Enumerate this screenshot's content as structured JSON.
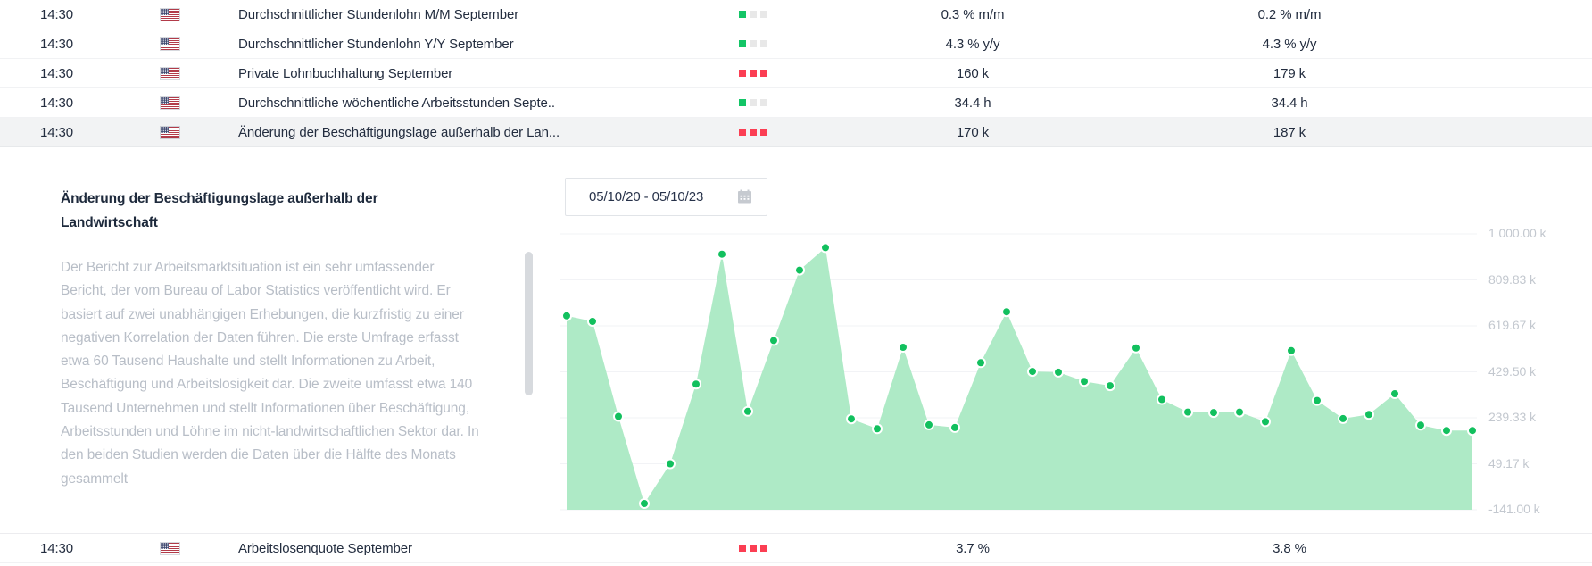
{
  "colors": {
    "impact_green": "#13c566",
    "impact_red": "#fb3e53",
    "impact_gray": "#e8e8e8",
    "area_fill": "#aeeac6",
    "marker_green": "#12c05e",
    "grid_line": "#f2f3f6",
    "selected_row_bg": "#f2f3f4",
    "text_dark": "#232d3f",
    "text_muted": "#b8bec7"
  },
  "table": {
    "rows": [
      {
        "time": "14:30",
        "country_icon": "us-flag-icon",
        "name": "Durchschnittlicher Stundenlohn M/M September",
        "impact": [
          "green",
          "gray",
          "gray"
        ],
        "forecast": "0.3 % m/m",
        "previous": "0.2 % m/m",
        "selected": false,
        "position": "top"
      },
      {
        "time": "14:30",
        "country_icon": "us-flag-icon",
        "name": "Durchschnittlicher Stundenlohn Y/Y September",
        "impact": [
          "green",
          "gray",
          "gray"
        ],
        "forecast": "4.3 % y/y",
        "previous": "4.3 % y/y",
        "selected": false,
        "position": "top"
      },
      {
        "time": "14:30",
        "country_icon": "us-flag-icon",
        "name": "Private Lohnbuchhaltung September",
        "impact": [
          "red",
          "red",
          "red"
        ],
        "forecast": "160 k",
        "previous": "179 k",
        "selected": false,
        "position": "top"
      },
      {
        "time": "14:30",
        "country_icon": "us-flag-icon",
        "name": "Durchschnittliche wöchentliche Arbeitsstunden Septe..",
        "impact": [
          "green",
          "gray",
          "gray"
        ],
        "forecast": "34.4 h",
        "previous": "34.4 h",
        "selected": false,
        "position": "top"
      },
      {
        "time": "14:30",
        "country_icon": "us-flag-icon",
        "name": "Änderung der Beschäftigungslage außerhalb der Lan...",
        "impact": [
          "red",
          "red",
          "red"
        ],
        "forecast": "170 k",
        "previous": "187 k",
        "selected": true,
        "position": "top"
      },
      {
        "time": "14:30",
        "country_icon": "us-flag-icon",
        "name": "Arbeitslosenquote September",
        "impact": [
          "red",
          "red",
          "red"
        ],
        "forecast": "3.7 %",
        "previous": "3.8 %",
        "selected": false,
        "position": "bottom"
      }
    ]
  },
  "detail": {
    "title": "Änderung der Beschäftigungslage außerhalb der Landwirtschaft",
    "description": "Der Bericht zur Arbeitsmarktsituation ist ein sehr umfassender Bericht, der vom Bureau of Labor Statistics veröffentlicht wird. Er basiert auf zwei unabhängigen Erhebungen, die kurzfristig zu einer negativen Korrelation der Daten führen. Die erste Umfrage erfasst etwa 60 Tausend Haushalte und stellt Informationen zu Arbeit, Beschäftigung und Arbeitslosigkeit dar. Die zweite umfasst etwa 140 Tausend Unternehmen und stellt Informationen über Beschäftigung, Arbeitsstunden und Löhne im nicht-landwirtschaftlichen Sektor dar. In den beiden Studien werden die Daten über die Hälfte des Monats gesammelt",
    "date_picker": {
      "value": "05/10/20 - 05/10/23",
      "icon": "calendar-icon"
    }
  },
  "chart_data": {
    "type": "area",
    "title": "Änderung der Beschäftigungslage außerhalb der Landwirtschaft",
    "date_range": "05/10/20 - 05/10/23",
    "unit": "k",
    "values": [
      661,
      638,
      245,
      -115,
      49,
      379,
      916,
      266,
      559,
      850,
      943,
      235,
      194,
      531,
      210,
      199,
      467,
      678,
      431,
      428,
      390,
      372,
      528,
      315,
      263,
      261,
      263,
      223,
      517,
      311,
      236,
      253,
      339,
      209,
      187,
      187
    ],
    "y_ticks": [
      "1 000.00 k",
      "809.83 k",
      "619.67 k",
      "429.50 k",
      "239.33 k",
      "49.17 k",
      "-141.00 k"
    ],
    "ylim": [
      -141,
      1000
    ],
    "grid": true,
    "x_labels_visible": false,
    "legend": "none"
  }
}
